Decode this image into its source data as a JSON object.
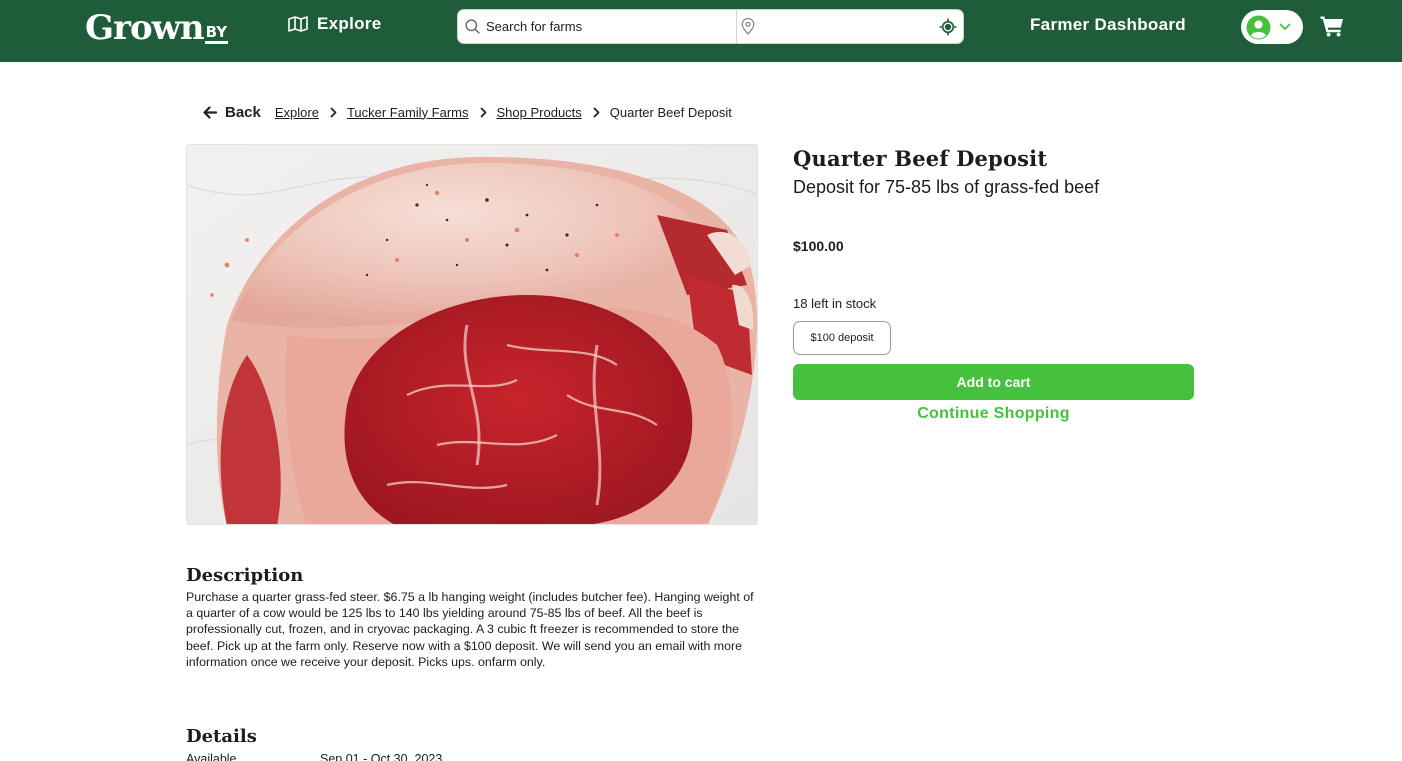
{
  "header": {
    "logo_main": "Grown",
    "logo_by": "BY",
    "explore_label": "Explore",
    "search_placeholder": "Search for farms",
    "location_placeholder": "",
    "farmer_dashboard_label": "Farmer Dashboard",
    "colors": {
      "bar": "#1e5c3a",
      "accent": "#46c13d"
    }
  },
  "breadcrumb": {
    "back_label": "Back",
    "items": [
      "Explore",
      "Tucker Family Farms",
      "Shop Products"
    ],
    "current": "Quarter Beef Deposit"
  },
  "product": {
    "title": "Quarter Beef Deposit",
    "subtitle": "Deposit for 75-85 lbs of grass-fed beef",
    "price": "$100.00",
    "stock": "18 left in stock",
    "option_label": "$100 deposit",
    "add_to_cart_label": "Add to cart",
    "continue_label": "Continue Shopping"
  },
  "description": {
    "heading": "Description",
    "body": "Purchase a quarter grass-fed steer. $6.75 a lb hanging weight (includes butcher fee). Hanging weight of a quarter of a cow would be 125 lbs to 140 lbs yielding around 75-85 lbs of beef. All the beef is professionally cut, frozen, and in cryovac packaging. A 3 cubic ft freezer is recommended to store the beef. Pick up at the farm only. Reserve now with a $100 deposit. We will send you an email with more information once we receive your deposit. Picks ups. onfarm only."
  },
  "details": {
    "heading": "Details",
    "available_label": "Available",
    "available_value": "Sep 01 - Oct 30, 2023"
  }
}
